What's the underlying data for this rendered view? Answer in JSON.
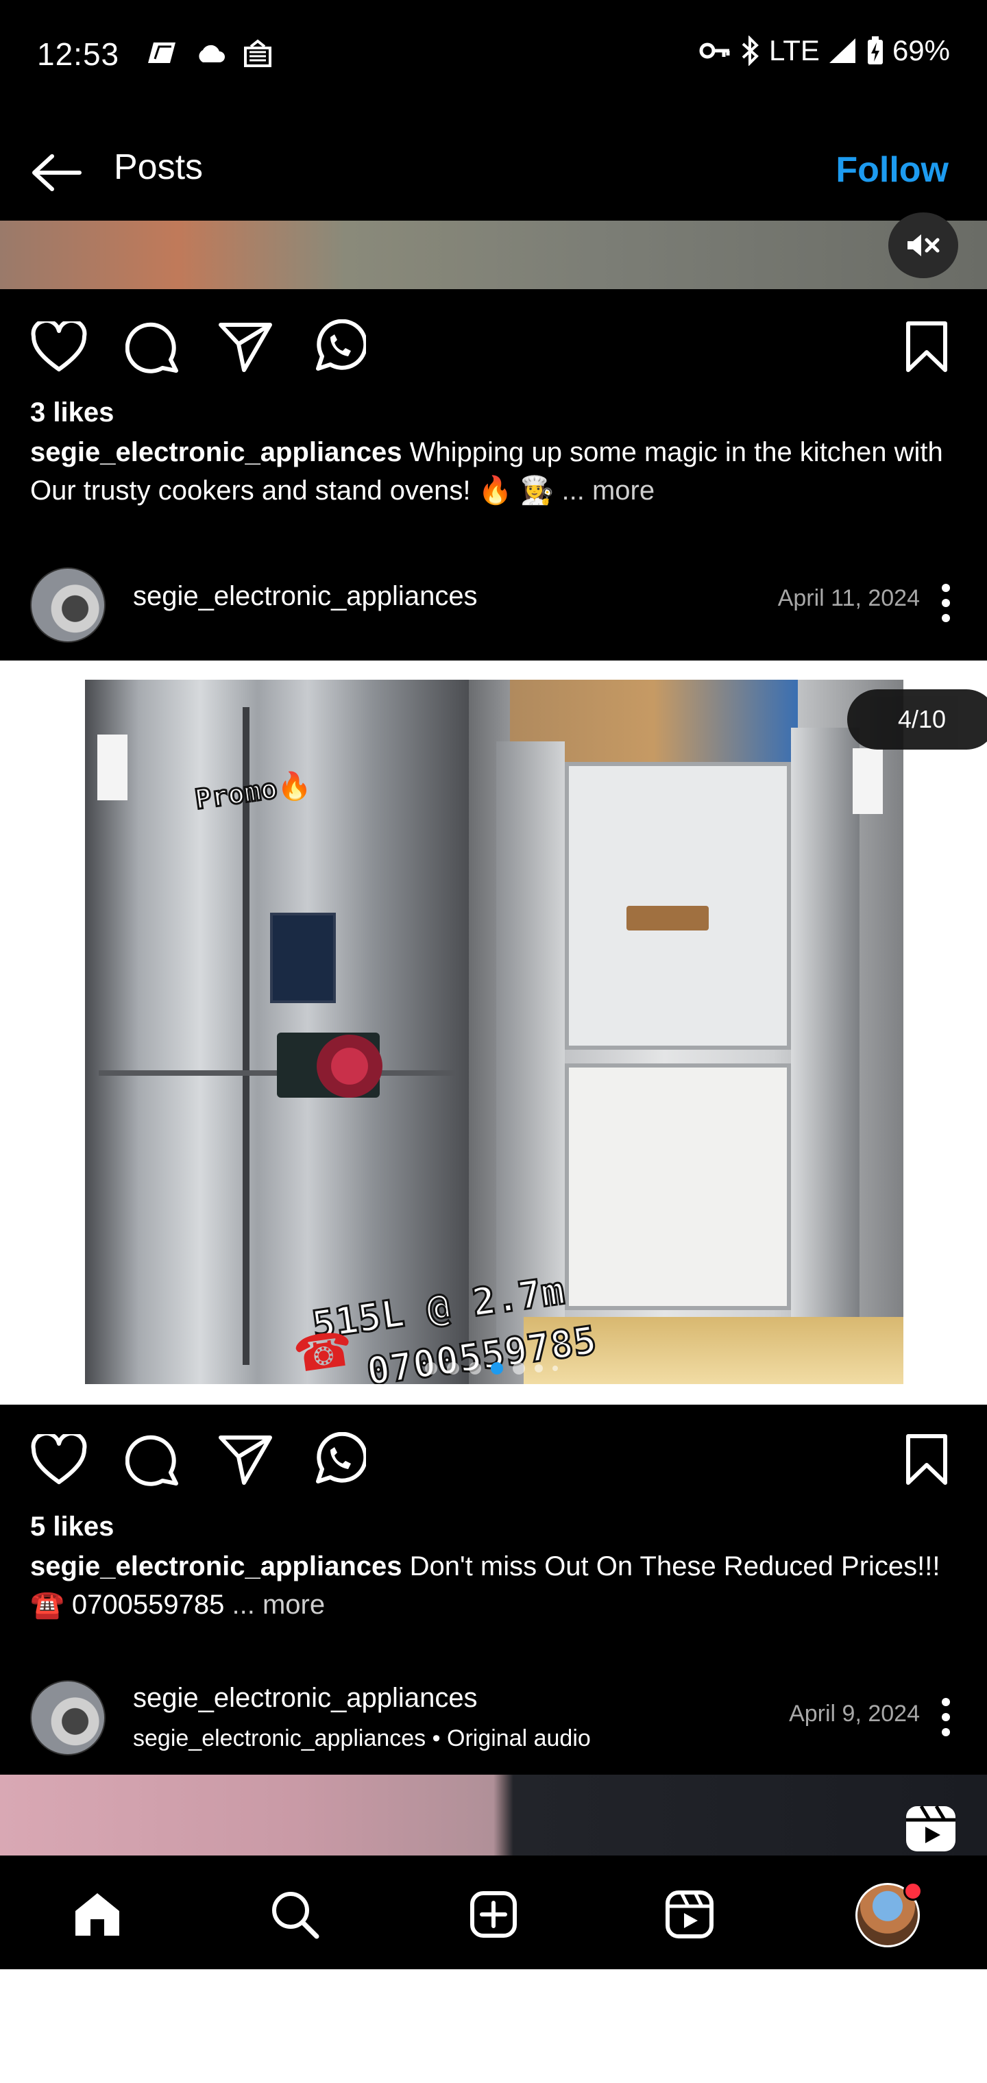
{
  "status_bar": {
    "time": "12:53",
    "network": "LTE",
    "battery": "69%"
  },
  "header": {
    "title": "Posts",
    "follow_label": "Follow"
  },
  "posts": [
    {
      "likes": "3 likes",
      "username": "segie_electronic_appliances",
      "caption": "Whipping up some magic in the kitchen with Our trusty cookers and stand ovens! 🔥 👩‍🍳",
      "more": " ... more"
    },
    {
      "username": "segie_electronic_appliances",
      "date": "April 11, 2024",
      "media_counter": "4/10",
      "slide_index": 4,
      "slide_total": 10,
      "overlay": {
        "promo": "Promo🔥",
        "price": "515L @ 2.7m",
        "phone": "0700559785"
      },
      "likes": "5 likes",
      "caption": "Don't miss Out On These Reduced Prices!!! ☎️ 0700559785",
      "more": "... more"
    },
    {
      "username": "segie_electronic_appliances",
      "audio_user": "segie_electronic_appliances",
      "audio_label": "Original audio",
      "date": "April 9, 2024"
    }
  ],
  "nav": {
    "items": [
      "home-icon",
      "search-icon",
      "create-icon",
      "reels-icon",
      "profile-avatar"
    ]
  },
  "colors": {
    "accent": "#1d9bf0",
    "background": "#000000",
    "notification": "#ff3040"
  }
}
